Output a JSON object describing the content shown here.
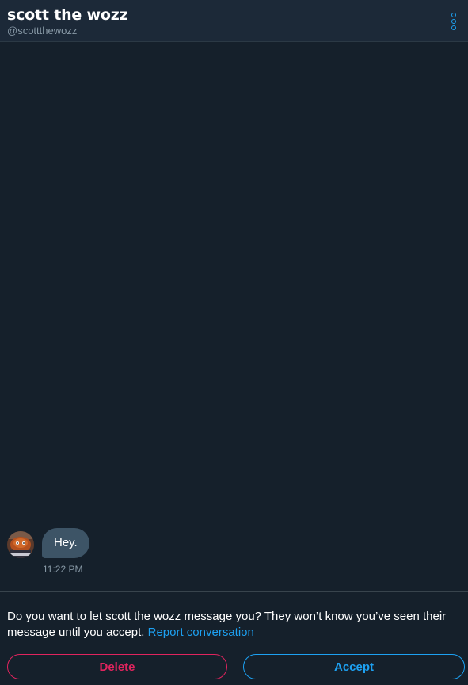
{
  "header": {
    "name": "scott the wozz",
    "handle": "@scottthewozz",
    "more_icon": "more-vertical-icon"
  },
  "conversation": {
    "messages": [
      {
        "sender": "scott the wozz",
        "text": "Hey.",
        "time": "11:22 PM"
      }
    ]
  },
  "request": {
    "prompt": "Do you want to let scott the wozz message you? They won’t know you’ve seen their message until you accept.",
    "report_label": "Report conversation",
    "delete_label": "Delete",
    "accept_label": "Accept"
  },
  "colors": {
    "background": "#15202b",
    "header": "#1c2938",
    "accent": "#1da1f2",
    "danger": "#e0245e",
    "bubble": "#3d5466",
    "muted": "#8899a6"
  }
}
